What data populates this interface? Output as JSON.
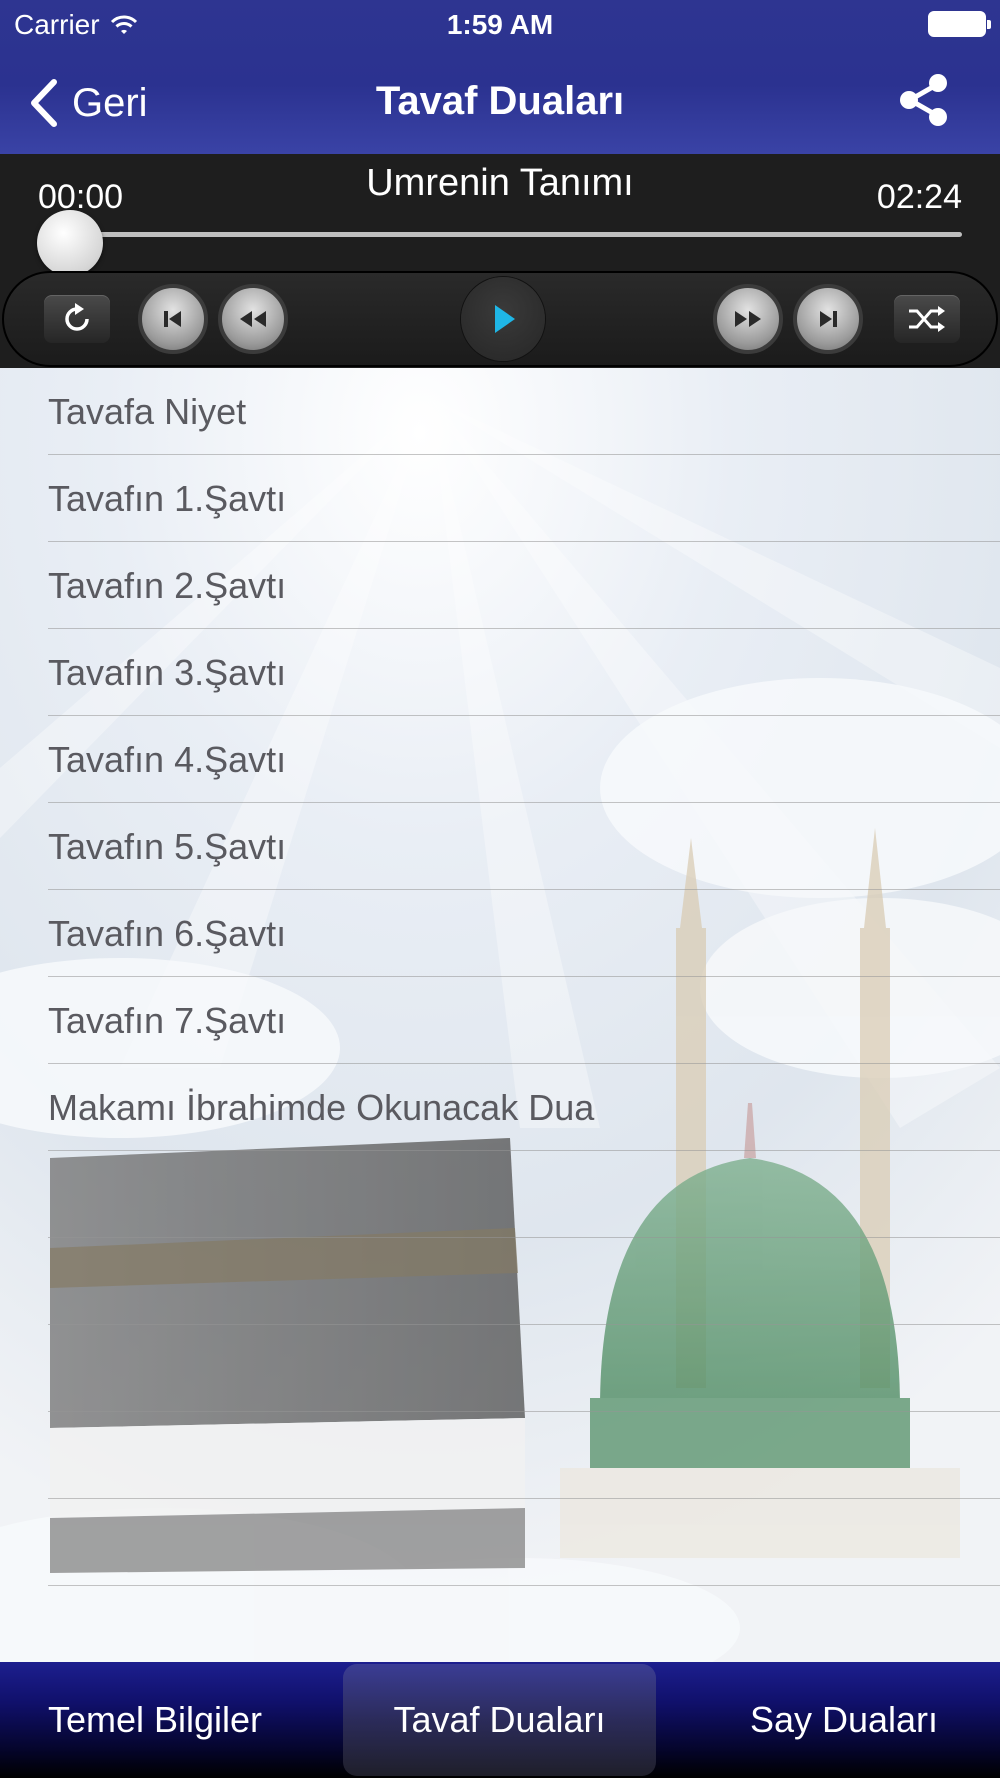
{
  "status_bar": {
    "carrier": "Carrier",
    "time": "1:59 AM"
  },
  "nav": {
    "back_label": "Geri",
    "title": "Tavaf Duaları"
  },
  "player": {
    "track_title": "Umrenin Tanımı",
    "time_elapsed": "00:00",
    "time_total": "02:24",
    "progress": 0.0,
    "controls": [
      "repeat-icon",
      "skip-previous-icon",
      "rewind-icon",
      "play-icon",
      "fast-forward-icon",
      "skip-next-icon",
      "shuffle-icon"
    ]
  },
  "list": {
    "items": [
      "Tavafa Niyet",
      "Tavafın 1.Şavtı",
      "Tavafın 2.Şavtı",
      "Tavafın 3.Şavtı",
      "Tavafın 4.Şavtı",
      "Tavafın 5.Şavtı",
      "Tavafın 6.Şavtı",
      "Tavafın 7.Şavtı",
      "Makamı İbrahimde Okunacak Dua",
      "",
      "",
      "",
      "",
      ""
    ]
  },
  "tabs": {
    "items": [
      "Temel Bilgiler",
      "Tavaf Duaları",
      "Say Duaları"
    ],
    "active": "Tavaf Duaları"
  },
  "colors": {
    "nav_bar": "#2e3591",
    "player_bg": "#1e1e1e",
    "play_accent": "#1fb6e6",
    "list_text": "#5a5a60"
  }
}
